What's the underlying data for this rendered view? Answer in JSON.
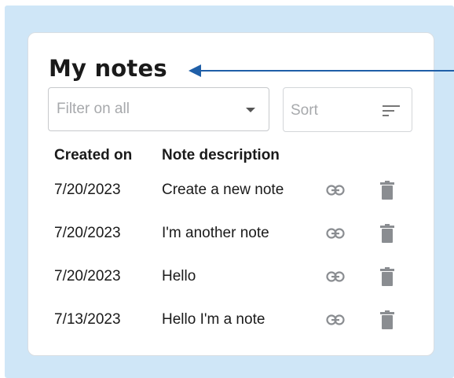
{
  "title": "My notes",
  "filter": {
    "placeholder": "Filter on all"
  },
  "sort": {
    "placeholder": "Sort"
  },
  "table": {
    "headers": [
      "Created on",
      "Note description"
    ],
    "rows": [
      {
        "date": "7/20/2023",
        "description": "Create a new note"
      },
      {
        "date": "7/20/2023",
        "description": "I'm another note"
      },
      {
        "date": "7/20/2023",
        "description": "Hello"
      },
      {
        "date": "7/13/2023",
        "description": "Hello I'm a note"
      }
    ]
  },
  "colors": {
    "backdrop": "#cfe6f7",
    "arrow": "#1f5fa8",
    "icon": "#8a8d91"
  },
  "icons": {
    "row_link": "link-icon",
    "row_delete": "trash-icon",
    "filter_caret": "chevron-down-icon",
    "sort": "sort-lines-icon"
  }
}
